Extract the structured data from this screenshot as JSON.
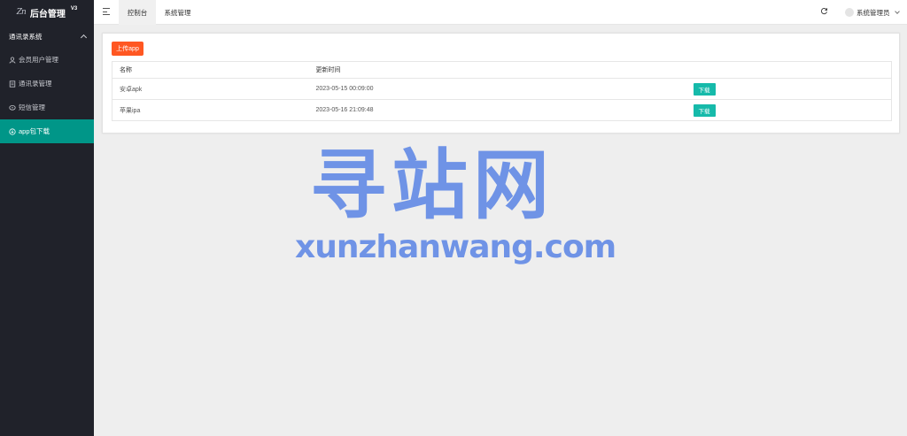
{
  "app": {
    "logo_mark": "Zn",
    "title": "后台管理",
    "version": "V3"
  },
  "sidebar": {
    "group": {
      "label": "通讯录系统",
      "expanded": true
    },
    "items": [
      {
        "label": "会员用户管理",
        "icon": "user-icon",
        "active": false
      },
      {
        "label": "通讯录管理",
        "icon": "book-icon",
        "active": false
      },
      {
        "label": "短信管理",
        "icon": "message-icon",
        "active": false
      },
      {
        "label": "app包下载",
        "icon": "download-icon",
        "active": true
      }
    ]
  },
  "header": {
    "tabs": [
      {
        "label": "控制台",
        "active": true
      },
      {
        "label": "系统管理",
        "active": false
      }
    ],
    "user_name": "系统管理员"
  },
  "main": {
    "upload_label": "上传app",
    "table": {
      "columns": [
        "名称",
        "更新时间",
        ""
      ],
      "rows": [
        {
          "name": "安卓apk",
          "updated": "2023-05-15 00:09:00",
          "action": "下载"
        },
        {
          "name": "苹果ipa",
          "updated": "2023-05-16 21:09:48",
          "action": "下载"
        }
      ]
    }
  },
  "watermark": {
    "cn": "寻站网",
    "en": "xunzhanwang.com"
  },
  "colors": {
    "sidebar_bg": "#20222a",
    "active_item": "#009688",
    "upload_button": "#ff5722",
    "download_button": "#16baaa",
    "watermark": "#6f93e6"
  }
}
